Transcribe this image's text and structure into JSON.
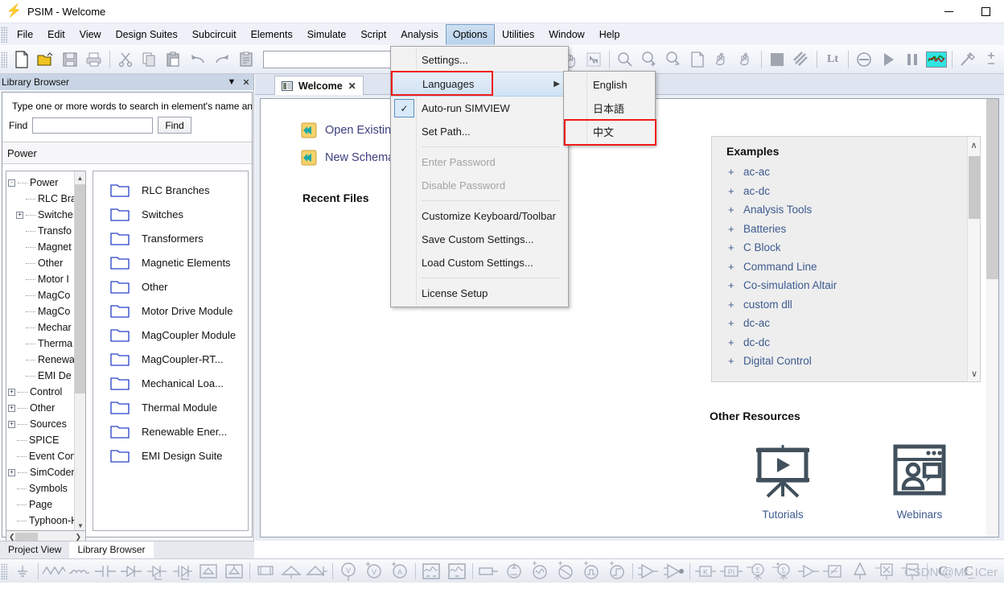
{
  "window": {
    "title": "PSIM - Welcome",
    "icon": "psim-bolt-icon",
    "minimize": "minimize",
    "maximize": "maximize"
  },
  "menubar": {
    "items": [
      {
        "label": "File"
      },
      {
        "label": "Edit"
      },
      {
        "label": "View"
      },
      {
        "label": "Design Suites"
      },
      {
        "label": "Subcircuit"
      },
      {
        "label": "Elements"
      },
      {
        "label": "Simulate"
      },
      {
        "label": "Script"
      },
      {
        "label": "Analysis"
      },
      {
        "label": "Options"
      },
      {
        "label": "Utilities"
      },
      {
        "label": "Window"
      },
      {
        "label": "Help"
      }
    ],
    "active": "Options"
  },
  "options_menu": {
    "items": [
      {
        "label": "Settings...",
        "type": "item"
      },
      {
        "label": "Languages",
        "type": "submenu",
        "highlighted": true,
        "arrow": "▶"
      },
      {
        "label": "Auto-run SIMVIEW",
        "type": "check",
        "checked": true,
        "check_glyph": "✓"
      },
      {
        "label": "Set Path...",
        "type": "item"
      },
      {
        "label": "",
        "type": "separator"
      },
      {
        "label": "Enter Password",
        "type": "item",
        "disabled": true
      },
      {
        "label": "Disable Password",
        "type": "item",
        "disabled": true
      },
      {
        "label": "",
        "type": "separator"
      },
      {
        "label": "Customize Keyboard/Toolbar",
        "type": "item"
      },
      {
        "label": "Save Custom Settings...",
        "type": "item"
      },
      {
        "label": "Load Custom Settings...",
        "type": "item"
      },
      {
        "label": "",
        "type": "separator"
      },
      {
        "label": "License Setup",
        "type": "item"
      }
    ]
  },
  "languages_submenu": {
    "items": [
      {
        "label": "English",
        "highlighted": false
      },
      {
        "label": "日本語",
        "highlighted": false
      },
      {
        "label": "中文",
        "highlighted": true
      }
    ]
  },
  "highlight_color": "#ef1b1b",
  "toolbar": {
    "buttons": [
      {
        "name": "new-file-icon"
      },
      {
        "name": "open-folder-icon"
      },
      {
        "name": "save-icon"
      },
      {
        "name": "print-icon"
      },
      {
        "name": "cut-icon"
      },
      {
        "name": "copy-icon"
      },
      {
        "name": "paste-icon"
      },
      {
        "name": "undo-icon"
      },
      {
        "name": "redo-icon"
      },
      {
        "name": "paste-special-icon"
      }
    ],
    "combo_value": "",
    "combo_arrow": "▼",
    "right_buttons": [
      {
        "name": "pan-hand-icon"
      },
      {
        "name": "select-arrow-icon"
      },
      {
        "name": "zoom-icon"
      },
      {
        "name": "zoom-in-icon"
      },
      {
        "name": "zoom-out-icon"
      },
      {
        "name": "fit-page-icon"
      },
      {
        "name": "hand-up-icon"
      },
      {
        "name": "hand-down-icon"
      },
      {
        "name": "block-icon"
      },
      {
        "name": "hatch-icon"
      },
      {
        "name": "lt-label",
        "label": "Lt"
      },
      {
        "name": "stop-icon"
      },
      {
        "name": "run-icon"
      },
      {
        "name": "pause-icon"
      },
      {
        "name": "simview-icon"
      },
      {
        "name": "probe-icon"
      },
      {
        "name": "plusminus-icon"
      }
    ]
  },
  "library_browser": {
    "title": "Library Browser",
    "collapse_glyph": "▼",
    "close_glyph": "✕",
    "hint": "Type one or more words to search in element's name and  desc",
    "find_label": "Find",
    "find_value": "",
    "find_placeholder": "",
    "find_button": "Find",
    "category": "Power",
    "tree": [
      {
        "label": "Power",
        "level": 0,
        "toggle": "-"
      },
      {
        "label": "RLC Bra",
        "level": 1,
        "toggle": ""
      },
      {
        "label": "Switche",
        "level": 1,
        "toggle": "+"
      },
      {
        "label": "Transfo",
        "level": 1,
        "toggle": ""
      },
      {
        "label": "Magnet",
        "level": 1,
        "toggle": ""
      },
      {
        "label": "Other",
        "level": 1,
        "toggle": ""
      },
      {
        "label": "Motor I",
        "level": 1,
        "toggle": ""
      },
      {
        "label": "MagCo",
        "level": 1,
        "toggle": ""
      },
      {
        "label": "MagCo",
        "level": 1,
        "toggle": ""
      },
      {
        "label": "Mechar",
        "level": 1,
        "toggle": ""
      },
      {
        "label": "Therma",
        "level": 1,
        "toggle": ""
      },
      {
        "label": "Renewa",
        "level": 1,
        "toggle": ""
      },
      {
        "label": "EMI De",
        "level": 1,
        "toggle": ""
      },
      {
        "label": "Control",
        "level": 0,
        "toggle": "+"
      },
      {
        "label": "Other",
        "level": 0,
        "toggle": "+"
      },
      {
        "label": "Sources",
        "level": 0,
        "toggle": "+"
      },
      {
        "label": "SPICE",
        "level": 0,
        "toggle": ""
      },
      {
        "label": "Event Cont",
        "level": 0,
        "toggle": ""
      },
      {
        "label": "SimCoder",
        "level": 0,
        "toggle": "+"
      },
      {
        "label": "Symbols",
        "level": 0,
        "toggle": ""
      },
      {
        "label": "Page",
        "level": 0,
        "toggle": ""
      },
      {
        "label": "Typhoon-H",
        "level": 0,
        "toggle": ""
      }
    ],
    "items": [
      {
        "label": "RLC Branches"
      },
      {
        "label": "Switches"
      },
      {
        "label": "Transformers"
      },
      {
        "label": "Magnetic Elements"
      },
      {
        "label": "Other"
      },
      {
        "label": "Motor Drive Module"
      },
      {
        "label": "MagCoupler Module"
      },
      {
        "label": "MagCoupler-RT..."
      },
      {
        "label": "Mechanical Loa..."
      },
      {
        "label": "Thermal Module"
      },
      {
        "label": "Renewable Ener..."
      },
      {
        "label": "EMI Design Suite"
      }
    ],
    "bottom_tabs": [
      {
        "label": "Project View",
        "selected": false
      },
      {
        "label": "Library Browser",
        "selected": true
      }
    ]
  },
  "document": {
    "tab": {
      "label": "Welcome",
      "close_glyph": "✕"
    },
    "links": [
      {
        "label": "Open Existing",
        "icon": "shortcut-arrow-icon"
      },
      {
        "label": "New Schemat",
        "icon": "shortcut-arrow-icon"
      }
    ],
    "recent_files_heading": "Recent Files",
    "examples": {
      "title": "Examples",
      "expand_glyph": "+",
      "items": [
        {
          "label": "ac-ac"
        },
        {
          "label": "ac-dc"
        },
        {
          "label": "Analysis Tools"
        },
        {
          "label": "Batteries"
        },
        {
          "label": "C Block"
        },
        {
          "label": "Command Line"
        },
        {
          "label": "Co-simulation Altair"
        },
        {
          "label": "custom dll"
        },
        {
          "label": "dc-ac"
        },
        {
          "label": "dc-dc"
        },
        {
          "label": "Digital Control"
        }
      ],
      "scroll_up": "∧",
      "scroll_down": "∨"
    },
    "other_resources": {
      "title": "Other Resources",
      "items": [
        {
          "label": "Tutorials",
          "icon": "presentation-play-icon"
        },
        {
          "label": "Webinars",
          "icon": "webinar-window-icon"
        }
      ]
    }
  },
  "bottom_toolbar": {
    "buttons": [
      {
        "name": "ground-icon"
      },
      {
        "name": "resistor-icon"
      },
      {
        "name": "inductor-icon"
      },
      {
        "name": "capacitor-icon"
      },
      {
        "name": "diode-icon"
      },
      {
        "name": "thyristor-icon"
      },
      {
        "name": "igbt-icon"
      },
      {
        "name": "bridge-rectifier-icon"
      },
      {
        "name": "bridge-thyristor-icon"
      },
      {
        "name": "transformer-icon"
      },
      {
        "name": "transformer-3w-icon"
      },
      {
        "name": "transformer-center-icon"
      },
      {
        "name": "voltmeter-icon"
      },
      {
        "name": "voltage-probe-icon"
      },
      {
        "name": "current-probe-icon"
      },
      {
        "name": "scope-icon"
      },
      {
        "name": "scope2-icon"
      },
      {
        "name": "load-icon"
      },
      {
        "name": "dc-source-icon"
      },
      {
        "name": "ac-source-icon"
      },
      {
        "name": "sine-source-icon"
      },
      {
        "name": "square-source-icon"
      },
      {
        "name": "step-source-icon"
      },
      {
        "name": "opamp-icon"
      },
      {
        "name": "comparator-icon"
      },
      {
        "name": "gain-k-icon"
      },
      {
        "name": "pi-controller-icon"
      },
      {
        "name": "summer-minus-icon"
      },
      {
        "name": "summer-plus-icon"
      },
      {
        "name": "buffer-icon"
      },
      {
        "name": "transfer-function-icon"
      },
      {
        "name": "logic-icon"
      },
      {
        "name": "multiplier-icon"
      },
      {
        "name": "divider-icon"
      },
      {
        "name": "c-block-icon",
        "label": "C"
      },
      {
        "name": "c-block2-icon",
        "label": "C"
      }
    ]
  },
  "watermark": "CSDN @Mr_ICer"
}
